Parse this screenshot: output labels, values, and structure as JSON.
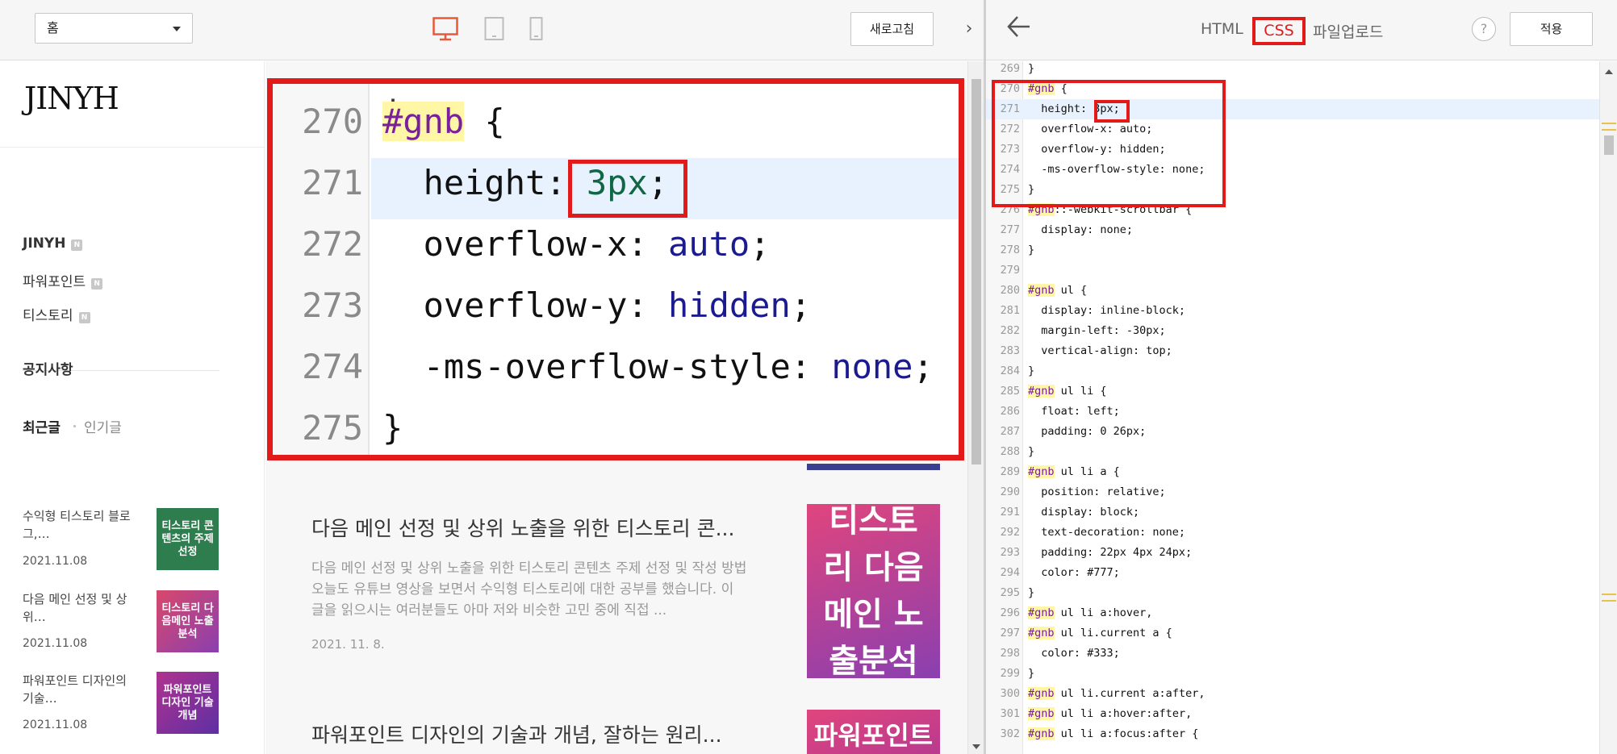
{
  "preview": {
    "page_select": "홈",
    "refresh_label": "새로고침",
    "collapse_glyph": "›",
    "blog_title": "JINYH",
    "categories": [
      {
        "label": "JINYH",
        "badge": "N"
      },
      {
        "label": "파워포인트",
        "badge": "N"
      },
      {
        "label": "티스토리",
        "badge": "N"
      }
    ],
    "notice_label": "공지사항",
    "tabs": {
      "recent": "최근글",
      "popular": "인기글"
    },
    "recent_posts": [
      {
        "title": "수익형 티스토리 블로그,…",
        "date": "2021.11.08",
        "thumb": "티스토리 콘텐츠의 주제선정",
        "color": "#2e7d4f"
      },
      {
        "title": "다음 메인 선정 및 상위…",
        "date": "2021.11.08",
        "thumb": "티스토리 다음메인 노출분석",
        "color": "#a23fa8"
      },
      {
        "title": "파워포인트 디자인의 기술…",
        "date": "2021.11.08",
        "thumb": "파워포인트 디자인 기술 개념",
        "color": "#8c2c9c"
      }
    ],
    "posts": [
      {
        "title": "다음 메인 선정 및 상위 노출을 위한 티스토리 콘...",
        "excerpt": "다음 메인 선정 및 상위 노출을 위한 티스토리 콘텐츠 주제 선정 및 작성 방법 오늘도 유튜브 영상을 보면서 수익형 티스토리에 대한 공부를 했습니다. 이 글을 읽으시는 여러분들도 아마 저와 비슷한 고민 중에 직접 ...",
        "date": "2021. 11. 8.",
        "thumb": "티스토리 다음메인 노출분석"
      },
      {
        "title": "파워포인트 디자인의 기술과 개념, 잘하는 원리...",
        "thumb": "파워포인트"
      }
    ],
    "zoom_lines": [
      {
        "n": "270",
        "sel": "#gnb",
        "rest": " {"
      },
      {
        "n": "271",
        "prop": "height: ",
        "val": "3px",
        "end": ";"
      },
      {
        "n": "272",
        "prop": "overflow-x: ",
        "val": "auto",
        "end": ";"
      },
      {
        "n": "273",
        "prop": "overflow-y: ",
        "val": "hidden",
        "end": ";"
      },
      {
        "n": "274",
        "prop": "-ms-overflow-style: ",
        "val": "none",
        "end": ";"
      },
      {
        "n": "275",
        "rest": "}"
      }
    ]
  },
  "editor_panel": {
    "tabs": [
      "HTML",
      "CSS",
      "파일업로드"
    ],
    "active_tab": "CSS",
    "help_label": "?",
    "apply_label": "적용",
    "code_lines": [
      {
        "n": "269",
        "s": "",
        "r": "}"
      },
      {
        "n": "270",
        "s": "#gnb",
        "r": " {"
      },
      {
        "n": "271",
        "s": "",
        "r": "  height: 3px;"
      },
      {
        "n": "272",
        "s": "",
        "r": "  overflow-x: auto;"
      },
      {
        "n": "273",
        "s": "",
        "r": "  overflow-y: hidden;"
      },
      {
        "n": "274",
        "s": "",
        "r": "  -ms-overflow-style: none;"
      },
      {
        "n": "275",
        "s": "",
        "r": "}"
      },
      {
        "n": "276",
        "s": "#gnb",
        "r": "::-webkit-scrollbar {"
      },
      {
        "n": "277",
        "s": "",
        "r": "  display: none;"
      },
      {
        "n": "278",
        "s": "",
        "r": "}"
      },
      {
        "n": "279",
        "s": "",
        "r": ""
      },
      {
        "n": "280",
        "s": "#gnb",
        "r": " ul {"
      },
      {
        "n": "281",
        "s": "",
        "r": "  display: inline-block;"
      },
      {
        "n": "282",
        "s": "",
        "r": "  margin-left: -30px;"
      },
      {
        "n": "283",
        "s": "",
        "r": "  vertical-align: top;"
      },
      {
        "n": "284",
        "s": "",
        "r": "}"
      },
      {
        "n": "285",
        "s": "#gnb",
        "r": " ul li {"
      },
      {
        "n": "286",
        "s": "",
        "r": "  float: left;"
      },
      {
        "n": "287",
        "s": "",
        "r": "  padding: 0 26px;"
      },
      {
        "n": "288",
        "s": "",
        "r": "}"
      },
      {
        "n": "289",
        "s": "#gnb",
        "r": " ul li a {"
      },
      {
        "n": "290",
        "s": "",
        "r": "  position: relative;"
      },
      {
        "n": "291",
        "s": "",
        "r": "  display: block;"
      },
      {
        "n": "292",
        "s": "",
        "r": "  text-decoration: none;"
      },
      {
        "n": "293",
        "s": "",
        "r": "  padding: 22px 4px 24px;"
      },
      {
        "n": "294",
        "s": "",
        "r": "  color: #777;"
      },
      {
        "n": "295",
        "s": "",
        "r": "}"
      },
      {
        "n": "296",
        "s": "#gnb",
        "r": " ul li a:hover,"
      },
      {
        "n": "297",
        "s": "#gnb",
        "r": " ul li.current a {"
      },
      {
        "n": "298",
        "s": "",
        "r": "  color: #333;"
      },
      {
        "n": "299",
        "s": "",
        "r": "}"
      },
      {
        "n": "300",
        "s": "#gnb",
        "r": " ul li.current a:after,"
      },
      {
        "n": "301",
        "s": "#gnb",
        "r": " ul li a:hover:after,"
      },
      {
        "n": "302",
        "s": "#gnb",
        "r": " ul li a:focus:after {"
      }
    ]
  },
  "colors": {
    "accent_red": "#e31a1a",
    "desktop_icon": "#e8593a",
    "current_line": "#e8f2ff",
    "selector_highlight": "#fff7a6"
  }
}
